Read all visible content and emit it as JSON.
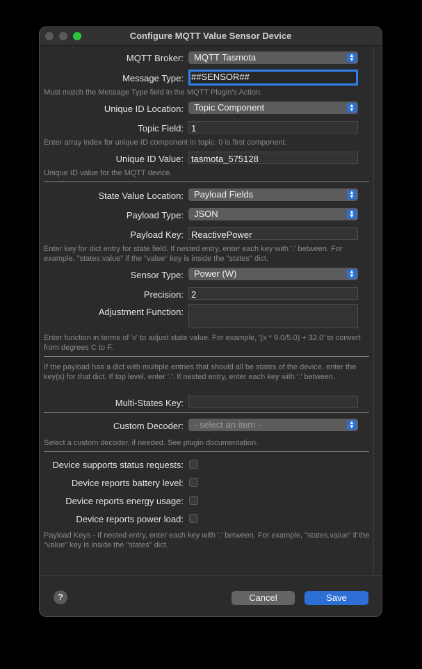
{
  "window": {
    "title": "Configure MQTT Value Sensor Device"
  },
  "fields": {
    "broker": {
      "label": "MQTT Broker:",
      "value": "MQTT Tasmota"
    },
    "message_type": {
      "label": "Message Type:",
      "value": "##SENSOR##"
    },
    "message_type_hint": "Must match the Message Type field in the MQTT Plugin's Action.",
    "uid_location": {
      "label": "Unique ID Location:",
      "value": "Topic Component"
    },
    "topic_field": {
      "label": "Topic Field:",
      "value": "1"
    },
    "topic_field_hint": "Enter array index for unique ID component in topic.  0 is first component.",
    "uid_value": {
      "label": "Unique ID Value:",
      "value": "tasmota_575128"
    },
    "uid_value_hint": "Unique ID value for the MQTT device.",
    "state_location": {
      "label": "State Value Location:",
      "value": "Payload Fields"
    },
    "payload_type": {
      "label": "Payload Type:",
      "value": "JSON"
    },
    "payload_key": {
      "label": "Payload Key:",
      "value": "ReactivePower"
    },
    "payload_key_hint": "Enter key for dict entry for state field.  If nested entry, enter each key with '.' between. For example, \"states.value\" if the \"value\" key is inside the \"states\" dict.",
    "sensor_type": {
      "label": "Sensor Type:",
      "value": "Power (W)"
    },
    "precision": {
      "label": "Precision:",
      "value": "2"
    },
    "adjustment": {
      "label": "Adjustment Function:",
      "value": ""
    },
    "adjustment_hint": "Enter function in terms of 'x' to adjust state value. For example, '(x * 9.0/5.0) + 32.0' to convert from degrees C to F.",
    "multi_states_hint": "If the payload has a dict with multiple entries that should all be states of the device, enter the key(s) for that dict.  If top level, enter '.'.  If nested entry, enter each key with '.' between.",
    "multi_states": {
      "label": "Multi-States Key:",
      "value": ""
    },
    "decoder": {
      "label": "Custom Decoder:",
      "value": "- select an item -"
    },
    "decoder_hint": "Select a custom decoder, if needed.  See plugin documentation."
  },
  "checkboxes": [
    {
      "label": "Device supports status requests:",
      "checked": false
    },
    {
      "label": "Device reports battery level:",
      "checked": false
    },
    {
      "label": "Device reports energy usage:",
      "checked": false
    },
    {
      "label": "Device reports power load:",
      "checked": false
    }
  ],
  "payload_keys_hint": "Payload Keys - If nested entry, enter each key with '.' between.  For example, \"states.value\" if the \"value\" key is inside the \"states\" dict.",
  "buttons": {
    "help": "?",
    "cancel": "Cancel",
    "save": "Save"
  },
  "colors": {
    "accent": "#2e6fd6",
    "window_bg": "#2b2b2b",
    "popup_bg": "#5c5c5c"
  }
}
